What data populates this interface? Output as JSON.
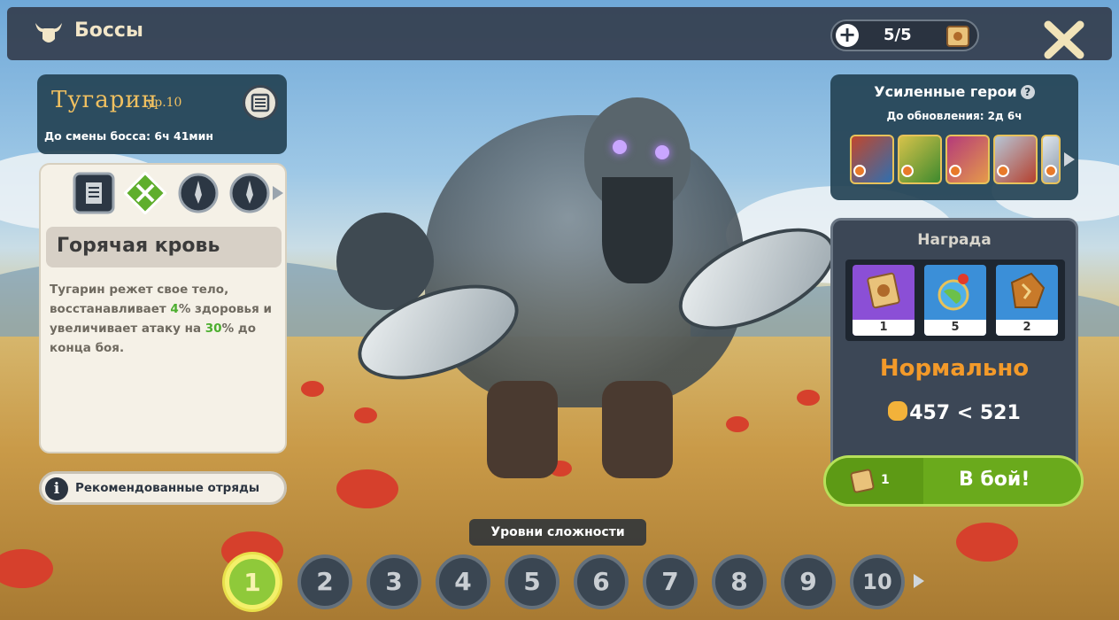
{
  "header": {
    "title": "Боссы",
    "icon": "ox-head-icon",
    "tickets": "5/5"
  },
  "boss": {
    "name": "Тугарин",
    "level": "ур.10",
    "change_timer": "До смены босса: 6ч 41мин"
  },
  "ability": {
    "title": "Горячая кровь",
    "desc_parts": [
      "Тугарин режет свое тело, восстанавливает ",
      "4",
      "% здоровья и увеличивает атаку на ",
      "30",
      "% до конца боя."
    ],
    "icons": [
      "scroll-icon",
      "crossed-swords-icon",
      "dagger-icon",
      "dagger-icon"
    ]
  },
  "recommended": {
    "label": "Рекомендованные отряды"
  },
  "boosted": {
    "title": "Усиленные герои",
    "subtitle": "До обновления: 2д 6ч",
    "heroes": [
      "hero-1",
      "hero-2",
      "hero-3",
      "hero-4",
      "hero-5"
    ]
  },
  "reward": {
    "title": "Награда",
    "items": [
      {
        "icon": "ticket-scroll-icon",
        "count": "1",
        "color": "#8b4fd6"
      },
      {
        "icon": "globe-pin-icon",
        "count": "5",
        "color": "#3b8fd8"
      },
      {
        "icon": "rune-stone-icon",
        "count": "2",
        "color": "#3b8fd8"
      }
    ],
    "difficulty": "Нормально",
    "power": "457 < 521"
  },
  "fight": {
    "cost": "1",
    "label": "В бой!"
  },
  "difficulty": {
    "label": "Уровни сложности",
    "levels": [
      "1",
      "2",
      "3",
      "4",
      "5",
      "6",
      "7",
      "8",
      "9",
      "10"
    ],
    "selected": "1"
  },
  "colors": {
    "accent_green": "#6aaa1c",
    "difficulty_orange": "#f39a2a",
    "boss_name_gold": "#f0c060"
  }
}
